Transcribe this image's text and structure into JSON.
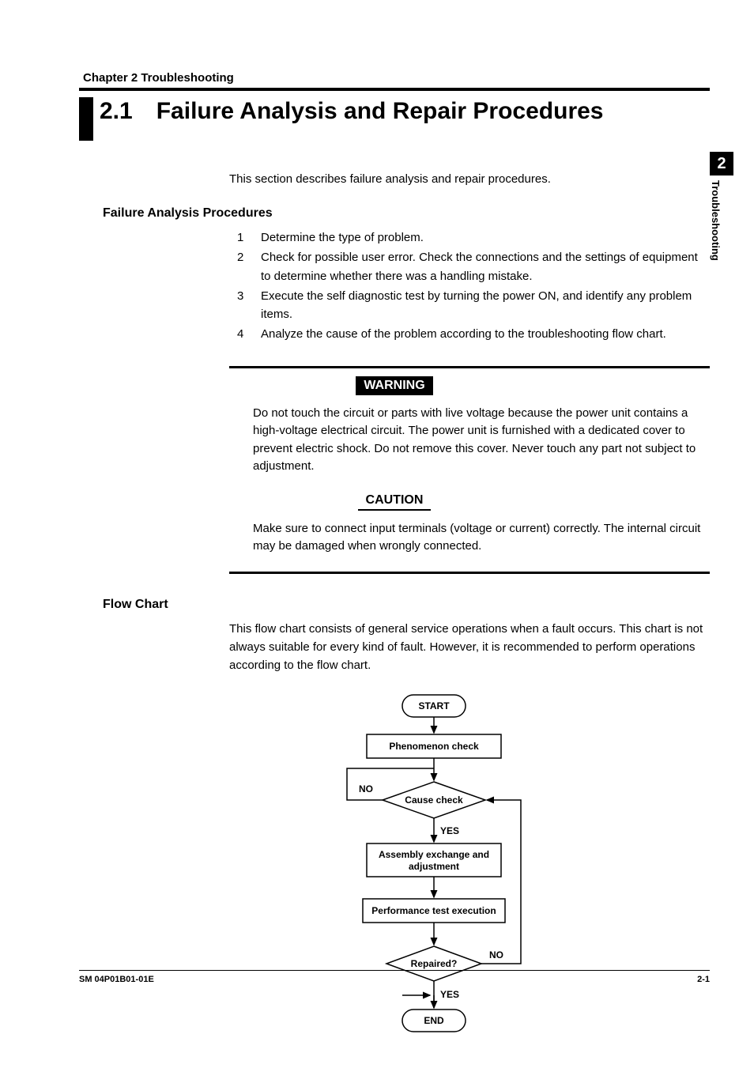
{
  "header": {
    "chapter_line": "Chapter 2   Troubleshooting",
    "section_number": "2.1",
    "section_title": "Failure Analysis and Repair Procedures"
  },
  "intro": "This section describes failure analysis and repair procedures.",
  "procedures": {
    "heading": "Failure Analysis Procedures",
    "steps": [
      {
        "n": "1",
        "t": "Determine the type of problem."
      },
      {
        "n": "2",
        "t": "Check for possible user error.  Check the connections and the settings of equipment to determine whether there was a handling mistake."
      },
      {
        "n": "3",
        "t": "Execute the self diagnostic test by turning the power ON, and identify any problem items."
      },
      {
        "n": "4",
        "t": "Analyze the cause of the problem according to the troubleshooting flow chart."
      }
    ]
  },
  "warning": {
    "label": "WARNING",
    "text": "Do not touch the circuit or parts with live voltage because the power unit contains a high-voltage electrical circuit.  The power unit is furnished with a dedicated cover to prevent electric shock.  Do not remove this cover.  Never touch any part not subject to adjustment."
  },
  "caution": {
    "label": "CAUTION",
    "text": "Make sure to connect input terminals (voltage or current) correctly.  The internal circuit may be damaged when wrongly connected."
  },
  "flowchart": {
    "heading": "Flow Chart",
    "intro": "This flow chart consists of general service operations when a fault occurs.  This chart is not always suitable for every kind of fault.  However, it is recommended to perform operations according to the flow chart.",
    "nodes": {
      "start": "START",
      "phenomenon": "Phenomenon check",
      "cause": "Cause check",
      "exchange": "Assembly exchange and adjustment",
      "perf": "Performance test execution",
      "repaired": "Repaired?",
      "end": "END"
    },
    "labels": {
      "yes": "YES",
      "no": "NO"
    }
  },
  "sidebar": {
    "number": "2",
    "title": "Troubleshooting"
  },
  "footer": {
    "left": "SM 04P01B01-01E",
    "right": "2-1"
  }
}
